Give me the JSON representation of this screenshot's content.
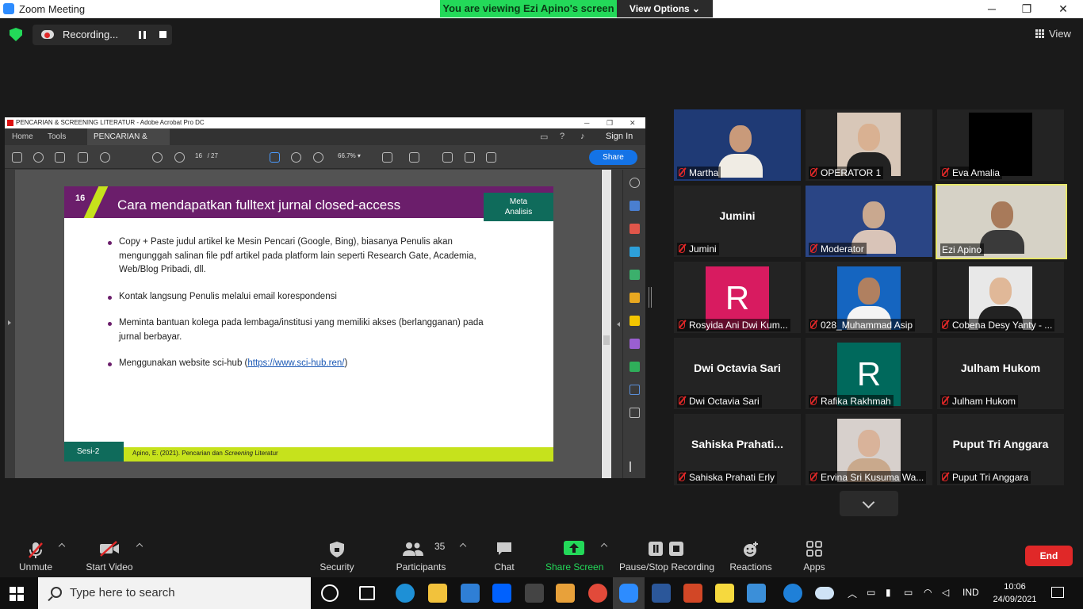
{
  "window": {
    "title": "Zoom Meeting",
    "minimize": "─",
    "maximize": "❐",
    "close": "✕"
  },
  "banner": {
    "viewing": "You are viewing Ezi Apino's screen",
    "view_options": "View Options ⌄"
  },
  "recording": {
    "label": "Recording..."
  },
  "view_button": "View",
  "acrobat": {
    "title": "PENCARIAN & SCREENING LITERATUR - Adobe Acrobat Pro DC",
    "tabs": {
      "home": "Home",
      "tools": "Tools",
      "doc": "PENCARIAN & SC...",
      "close": "×"
    },
    "sign_in": "Sign In",
    "page_current": "16",
    "page_total": "/ 27",
    "zoom": "66.7%",
    "share": "Share"
  },
  "slide": {
    "number": "16",
    "title": "Cara mendapatkan fulltext jurnal closed-access",
    "tag_line1": "Meta",
    "tag_line2": "Analisis",
    "bullets": [
      "Copy + Paste judul artikel ke Mesin Pencari (Google, Bing), biasanya Penulis akan mengunggah salinan file pdf artikel pada platform lain seperti Research Gate, Academia, Web/Blog Pribadi, dll.",
      "Kontak langsung Penulis melalui email korespondensi",
      "Meminta bantuan kolega pada lembaga/institusi yang memiliki akses (berlangganan) pada jurnal berbayar."
    ],
    "bullet4_prefix": "Menggunakan website sci-hub (",
    "bullet4_link": "https://www.sci-hub.ren/",
    "bullet4_suffix": ")",
    "session": "Sesi-2",
    "citation_prefix": "Apino, E. (2021). Pencarian dan ",
    "citation_italic": "Screening",
    "citation_suffix": " Literatur"
  },
  "participants": [
    {
      "name": "Martha",
      "type": "video",
      "bg": "#1f3a75"
    },
    {
      "name": "OPERATOR 1",
      "type": "video",
      "bg": "#d8c7b8"
    },
    {
      "name": "Eva Amalia",
      "type": "black"
    },
    {
      "name": "Jumini",
      "display": "Jumini",
      "type": "text"
    },
    {
      "name": "Moderator",
      "type": "video",
      "bg": "#2a4585"
    },
    {
      "name": "Ezi Apino",
      "type": "video",
      "bg": "#d6d2c6",
      "active": true
    },
    {
      "name": "Rosyida Ani Dwi Kum...",
      "type": "avatar",
      "letter": "R",
      "bg": "#d81b60"
    },
    {
      "name": "028_Muhammad Asip",
      "type": "video",
      "bg": "#1565c0"
    },
    {
      "name": "Cobena Desy Yanty - ...",
      "type": "video",
      "bg": "#e8e8e8"
    },
    {
      "name": "Dwi Octavia Sari",
      "display": "Dwi Octavia Sari",
      "type": "text"
    },
    {
      "name": "Rafika Rakhmah",
      "type": "avatar",
      "letter": "R",
      "bg": "#00695c"
    },
    {
      "name": "Julham Hukom",
      "display": "Julham Hukom",
      "type": "text"
    },
    {
      "name": "Sahiska Prahati Erly",
      "display": "Sahiska  Prahati...",
      "type": "text"
    },
    {
      "name": "Ervina Sri Kusuma Wa...",
      "type": "video",
      "bg": "#d7d0cc"
    },
    {
      "name": "Puput Tri Anggara",
      "display": "Puput Tri Anggara",
      "type": "text"
    }
  ],
  "toolbar": {
    "unmute": "Unmute",
    "start_video": "Start Video",
    "security": "Security",
    "participants": "Participants",
    "participants_count": "35",
    "chat": "Chat",
    "share_screen": "Share Screen",
    "pause_stop": "Pause/Stop Recording",
    "reactions": "Reactions",
    "apps": "Apps",
    "end": "End"
  },
  "taskbar": {
    "search_placeholder": "Type here to search",
    "language": "IND",
    "time": "10:06",
    "date": "24/09/2021"
  }
}
